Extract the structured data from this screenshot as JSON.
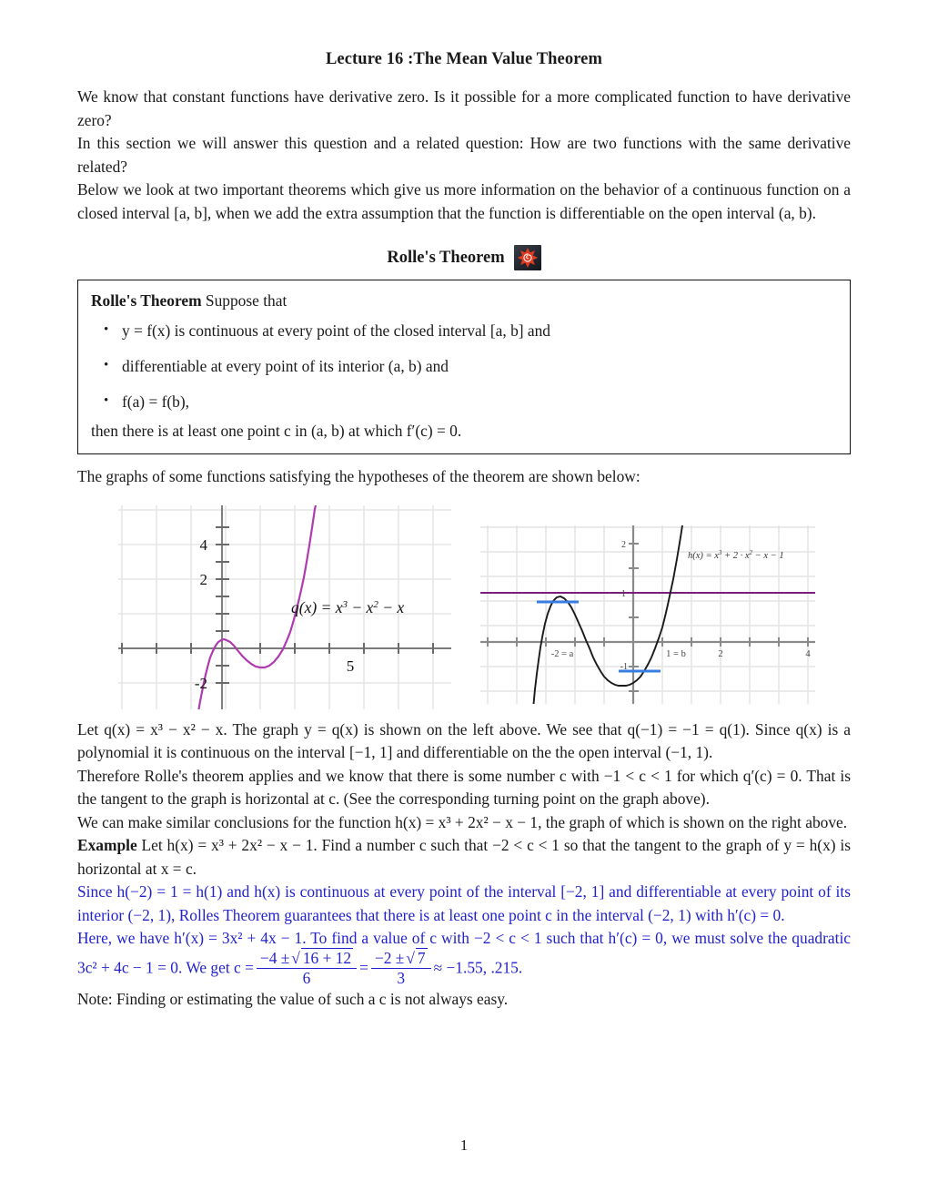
{
  "document": {
    "title": "Lecture 16 :The Mean Value Theorem",
    "page_number": "1"
  },
  "intro": {
    "p1": "We know that constant functions have derivative zero. Is it possible for a more complicated function to have derivative zero?",
    "p2": "In this section we will answer this question and a related question: How are two functions with the same derivative related?",
    "p3": "Below we look at two important theorems which give us more information on the behavior of a continuous function on a closed interval [a, b], when we add the extra assumption that the function is differentiable on the open interval (a, b)."
  },
  "rolle_heading": {
    "label": "Rolle's Theorem",
    "icon": "sunburst-spiral-icon"
  },
  "theorem_box": {
    "name_bold": "Rolle's Theorem",
    "lead_rest": " Suppose that",
    "bullets": [
      "y = f(x) is continuous at every point of the closed interval [a, b] and",
      "differentiable at every point of its interior (a, b) and",
      "f(a) = f(b),"
    ],
    "tail": "then there is at least one point c in (a, b) at which f′(c) = 0."
  },
  "graphs_intro": "The graphs of some functions satisfying the hypotheses of the theorem are shown below:",
  "chart_data": [
    {
      "type": "line",
      "id": "left-graph",
      "title": "",
      "function_label": "q(x) = x³ − x² − x",
      "expression": "x^3 - x^2 - x",
      "curve_color": "#b03ab0",
      "grid": true,
      "grid_color": "#e6e6e6",
      "axis_color": "#666666",
      "xlim": [
        -2.2,
        7.8
      ],
      "ylim": [
        -2.4,
        5.6
      ],
      "y_ticks": [
        2,
        4
      ],
      "y_tick_labels": [
        "2",
        "4",
        "-2"
      ],
      "x_tick_labels": [
        "5"
      ],
      "xlabel": "",
      "ylabel": ""
    },
    {
      "type": "line",
      "id": "right-graph",
      "title": "",
      "function_label": "h(x) = x³ + 2 · x² − x − 1",
      "expression": "x^3 + 2x^2 - x - 1",
      "curve_color": "#1a1a1a",
      "grid": true,
      "grid_color": "#e4e4e4",
      "axis_color": "#808080",
      "xlim": [
        -3.2,
        4.8
      ],
      "ylim": [
        -2.3,
        2.6
      ],
      "y_tick_labels": [
        "2",
        "1",
        "-1"
      ],
      "x_tick_labels": [
        "-2 = a",
        "1 = b",
        "2",
        "4"
      ],
      "secant_line": {
        "y": 1,
        "color": "#7a1f7a",
        "label": "1"
      },
      "tangent_segments": [
        {
          "at_x": -1.549,
          "y": 1.631,
          "color": "#3a7de0"
        },
        {
          "at_x": 0.215,
          "y": -1.113,
          "color": "#3a7de0"
        }
      ],
      "xlabel": "",
      "ylabel": ""
    }
  ],
  "body": {
    "p_q_1": "Let q(x) = x³ − x² − x. The graph y = q(x) is shown on the left above. We see that q(−1) = −1 = q(1). Since q(x) is a polynomial it is continuous on the interval [−1, 1] and differentiable on the the open interval (−1, 1).",
    "p_q_2": "Therefore Rolle's theorem applies and we know that there is some number c with −1 < c < 1 for which q′(c) = 0. That is the tangent to the graph is horizontal at c. (See the corresponding turning point on the graph above).",
    "p_h_1": "We can make similar conclusions for the function h(x) = x³ + 2x² − x − 1, the graph of which is shown on the right above.",
    "example_label": "Example",
    "example_rest": " Let h(x) = x³ + 2x² − x − 1. Find a number c such that −2 < c < 1 so that the tangent to the graph of y = h(x) is horizontal at x = c.",
    "solution_1": "Since h(−2) = 1 = h(1) and h(x) is continuous at every point of the interval [−2, 1] and differentiable at every point of its interior (−2, 1), Rolles Theorem guarantees that there is at least one point c in the interval (−2, 1) with h′(c) = 0.",
    "solution_2_pre": "Here, we have h′(x) = 3x² + 4x − 1. To find a value of c with −2 < c < 1 such that h′(c) = 0, we must solve the quadratic 3c² + 4c − 1 = 0. We get c =",
    "frac1_num": "−4 ±",
    "frac1_radicand": "16 + 12",
    "frac1_den": "6",
    "equals": "=",
    "frac2_num": "−2 ±",
    "frac2_radicand": "7",
    "frac2_den": "3",
    "approx_tail": "≈ −1.55, .215.",
    "note": "Note: Finding or estimating the value of such a c is not always easy."
  },
  "colors": {
    "blue_text": "#2222cc",
    "left_curve": "#b03ab0",
    "right_curve": "#1a1a1a",
    "secant": "#7a1f7a",
    "tangent": "#3a7de0",
    "icon_red": "#e03a20"
  }
}
